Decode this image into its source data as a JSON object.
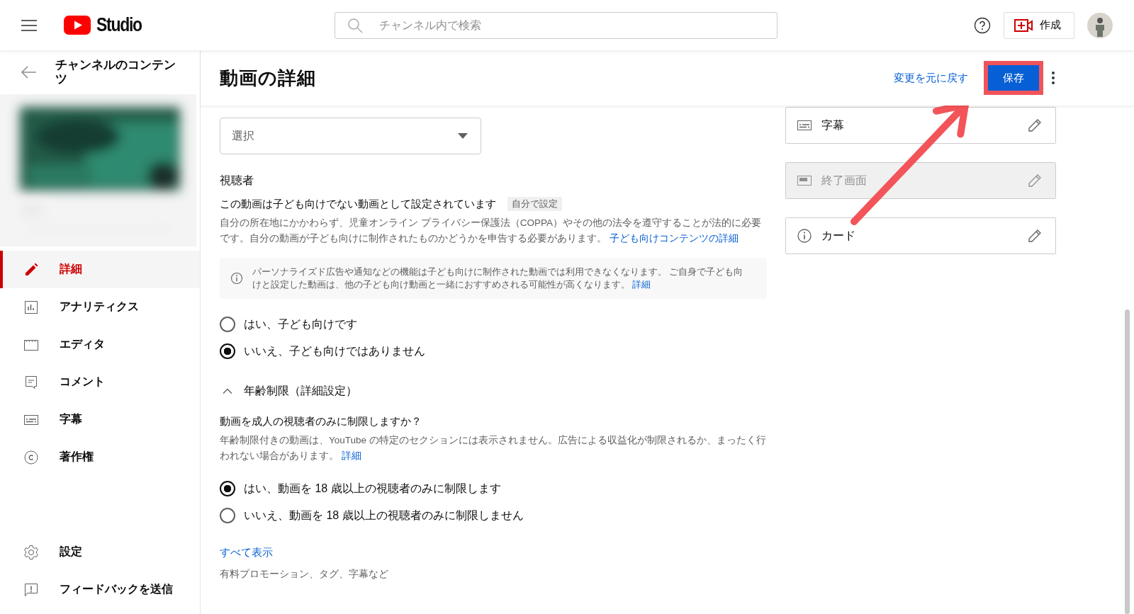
{
  "header": {
    "logo_text": "Studio",
    "search_placeholder": "チャンネル内で検索",
    "create_label": "作成"
  },
  "sidebar": {
    "back_title": "チャンネルのコンテンツ",
    "items": [
      {
        "label": "詳細",
        "kind": "pencil",
        "selected": true
      },
      {
        "label": "アナリティクス",
        "kind": "chart",
        "selected": false
      },
      {
        "label": "エディタ",
        "kind": "clapper",
        "selected": false
      },
      {
        "label": "コメント",
        "kind": "comment",
        "selected": false
      },
      {
        "label": "字幕",
        "kind": "subtitles",
        "selected": false
      },
      {
        "label": "著作権",
        "kind": "copyright",
        "selected": false
      }
    ],
    "footer_items": [
      {
        "label": "設定",
        "kind": "gear",
        "selected": false
      },
      {
        "label": "フィードバックを送信",
        "kind": "feedback",
        "selected": false
      }
    ]
  },
  "page_header": {
    "title": "動画の詳細",
    "undo_link": "変更を元に戻す",
    "save_button": {
      "label": "保存",
      "highlighted": true
    },
    "annotation_arrow": true
  },
  "form": {
    "select": {
      "placeholder": "選択"
    },
    "audience": {
      "heading": "視聴者",
      "status": "この動画は子ども向けでない動画として設定されています",
      "status_tag": "自分で設定",
      "description": "自分の所在地にかかわらず、児童オンライン プライバシー保護法（COPPA）やその他の法令を遵守することが法的に必要です。自分の動画が子ども向けに制作されたものかどうかを申告する必要があります。",
      "description_link": "子ども向けコンテンツの詳細",
      "info": "パーソナライズド広告や通知などの機能は子ども向けに制作された動画では利用できなくなります。 ご自身で子ども向けと設定した動画は、他の子ども向け動画と一緒におすすめされる可能性が高くなります。",
      "info_link": "詳細",
      "options": [
        {
          "label": "はい、子ども向けです",
          "selected": false
        },
        {
          "label": "いいえ、子ども向けではありません",
          "selected": true
        }
      ]
    },
    "age_restriction": {
      "toggle": "年齢制限（詳細設定）",
      "expanded": true,
      "question": "動画を成人の視聴者のみに制限しますか？",
      "description": "年齢制限付きの動画は、YouTube の特定のセクションには表示されません。広告による収益化が制限されるか、まったく行われない場合があります。",
      "description_link": "詳細",
      "options": [
        {
          "label": "はい、動画を 18 歳以上の視聴者のみに制限します",
          "selected": true
        },
        {
          "label": "いいえ、動画を 18 歳以上の視聴者のみに制限しません",
          "selected": false
        }
      ]
    },
    "show_all": "すべて表示",
    "show_all_summary": "有料プロモーション、タグ、字幕など"
  },
  "cards": [
    {
      "label": "字幕",
      "kind": "subtitles",
      "disabled": false
    },
    {
      "label": "終了画面",
      "kind": "endscreen",
      "disabled": true
    },
    {
      "label": "カード",
      "kind": "info",
      "disabled": false
    }
  ]
}
